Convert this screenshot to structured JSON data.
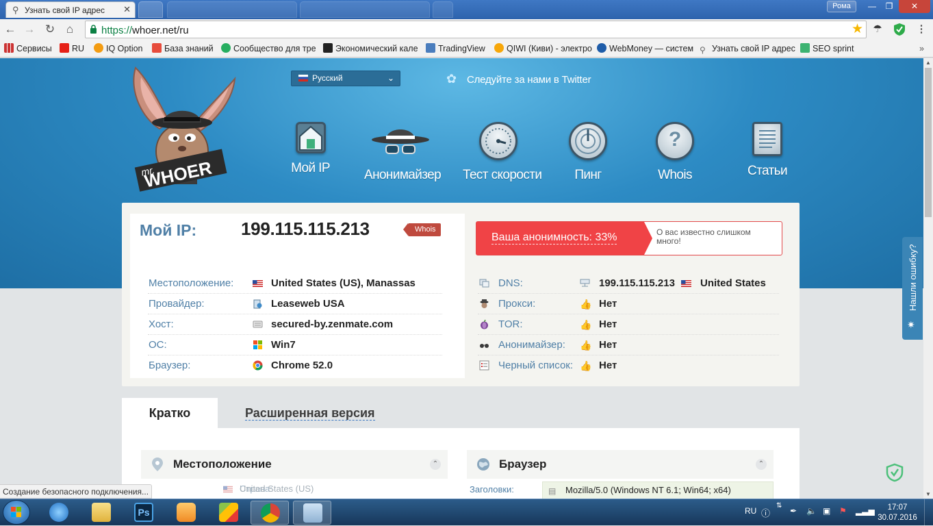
{
  "browser": {
    "active_tab_title": "Узнать свой IP адрес",
    "url_scheme": "https://",
    "url_rest": "whoer.net/ru",
    "profile_name": "Рома",
    "bookmarks": [
      "Сервисы",
      "RU",
      "IQ Option",
      "База знаний",
      "Сообщество для тре",
      "Экономический кале",
      "TradingView",
      "QIWI (Киви) - электро",
      "WebMoney — систем",
      "Узнать свой IP адрес",
      "SEO sprint"
    ],
    "status_text": "Создание безопасного подключения..."
  },
  "header": {
    "language": "Русский",
    "twitter": "Следуйте за нами в Twitter",
    "mascot_text": "mr. WHOER",
    "nav": [
      "Мой IP",
      "Анонимайзер",
      "Тест скорости",
      "Пинг",
      "Whois",
      "Статьи"
    ]
  },
  "ip": {
    "label": "Мой IP:",
    "value": "199.115.115.213",
    "whois": "Whois"
  },
  "details": [
    {
      "key": "Местоположение:",
      "value": "United States (US), Manassas"
    },
    {
      "key": "Провайдер:",
      "value": "Leaseweb USA"
    },
    {
      "key": "Хост:",
      "value": "secured-by.zenmate.com"
    },
    {
      "key": "ОС:",
      "value": "Win7"
    },
    {
      "key": "Браузер:",
      "value": "Chrome 52.0"
    }
  ],
  "anonymity": {
    "label": "Ваша анонимность: 33%",
    "percent": 33,
    "note": "О вас известно слишком много!"
  },
  "checks": [
    {
      "key": "DNS:",
      "value": "199.115.115.213",
      "extra": "United States"
    },
    {
      "key": "Прокси:",
      "value": "Нет"
    },
    {
      "key": "TOR:",
      "value": "Нет"
    },
    {
      "key": "Анонимайзер:",
      "value": "Нет"
    },
    {
      "key": "Черный список:",
      "value": "Нет"
    }
  ],
  "tabs": {
    "brief": "Кратко",
    "extended": "Расширенная версия"
  },
  "sections": {
    "location": {
      "title": "Местоположение",
      "country_label": "Страна:",
      "country_value": "United States (US)"
    },
    "browser": {
      "title": "Браузер",
      "headers_label": "Заголовки:",
      "headers_value": "Mozilla/5.0 (Windows NT 6.1; Win64; x64)"
    }
  },
  "side": {
    "report": "Нашли ошибку?"
  },
  "taskbar": {
    "lang": "RU",
    "time": "17:07",
    "date": "30.07.2016"
  },
  "colors": {
    "accent_blue": "#4f7fa6",
    "danger_red": "#f04346",
    "hero_blue": "#2d8bc4"
  }
}
